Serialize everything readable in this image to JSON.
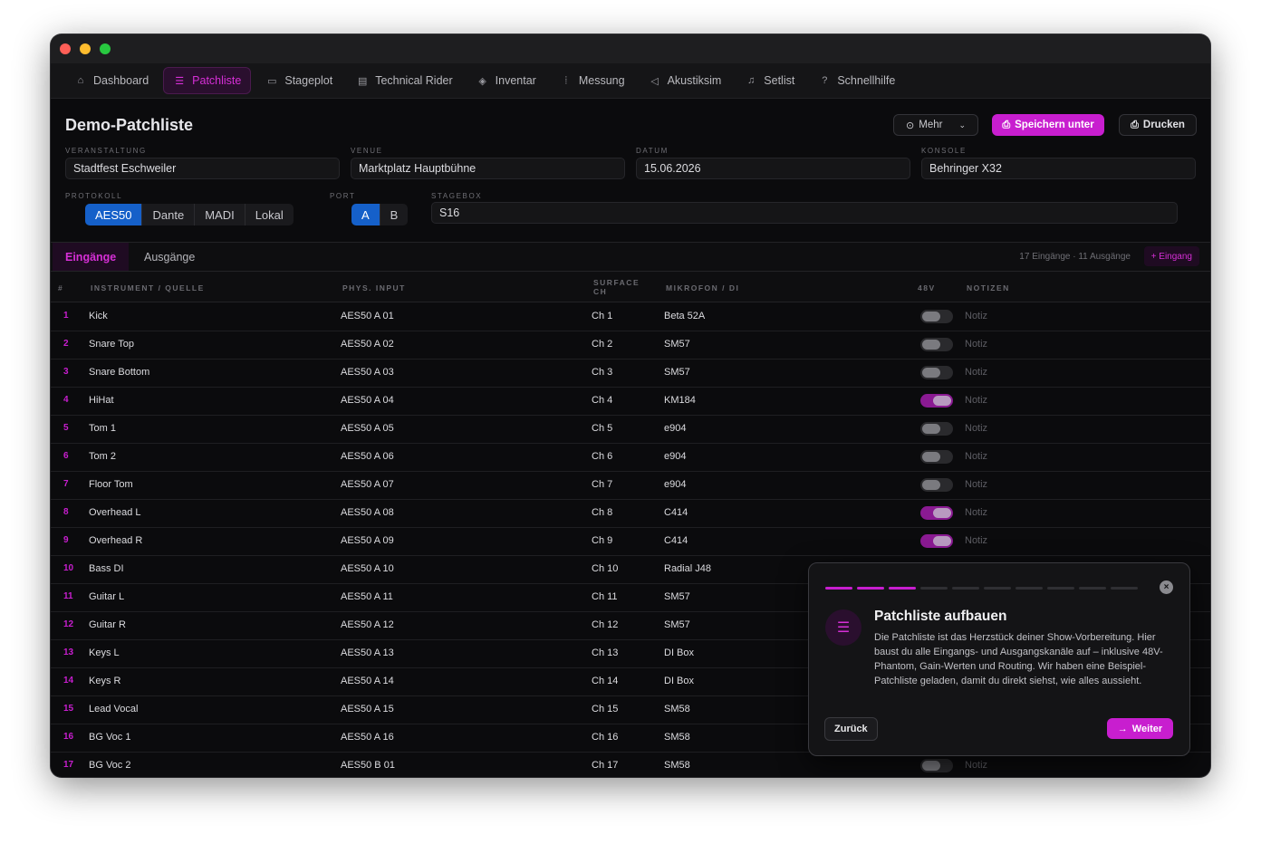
{
  "nav": [
    {
      "label": "Dashboard",
      "icon": "home-icon",
      "active": false
    },
    {
      "label": "Patchliste",
      "icon": "list-icon",
      "active": true
    },
    {
      "label": "Stageplot",
      "icon": "stageplot-icon",
      "active": false
    },
    {
      "label": "Technical Rider",
      "icon": "document-icon",
      "active": false
    },
    {
      "label": "Inventar",
      "icon": "box-icon",
      "active": false
    },
    {
      "label": "Messung",
      "icon": "waveform-icon",
      "active": false
    },
    {
      "label": "Akustiksim",
      "icon": "speaker-icon",
      "active": false
    },
    {
      "label": "Setlist",
      "icon": "music-icon",
      "active": false
    },
    {
      "label": "Schnellhilfe",
      "icon": "help-icon",
      "active": false
    }
  ],
  "header": {
    "title": "Demo-Patchliste",
    "more_label": "Mehr",
    "save_label": "Speichern unter",
    "print_label": "Drucken"
  },
  "fields": {
    "event_label": "Veranstaltung",
    "event_value": "Stadtfest Eschweiler",
    "venue_label": "Venue",
    "venue_value": "Marktplatz Hauptbühne",
    "date_label": "Datum",
    "date_value": "15.06.2026",
    "console_label": "Konsole",
    "console_value": "Behringer X32",
    "protocol_label": "Protokoll",
    "protocols": [
      "AES50",
      "Dante",
      "MADI",
      "Lokal"
    ],
    "protocol_selected": "AES50",
    "port_label": "Port",
    "ports": [
      "A",
      "B"
    ],
    "port_selected": "A",
    "stagebox_label": "Stagebox",
    "stagebox_value": "S16"
  },
  "tabs": {
    "inputs": "Eingänge",
    "outputs": "Ausgänge",
    "counts": "17 Eingänge · 11 Ausgänge",
    "add_label": "+ Eingang"
  },
  "columns": {
    "num": "#",
    "instrument": "Instrument / Quelle",
    "phys": "Phys. Input",
    "surface": "Surface Ch",
    "mic": "Mikrofon / DI",
    "phantom": "48V",
    "notes": "Notizen"
  },
  "rows": [
    {
      "n": "1",
      "instrument": "Kick",
      "input": "AES50 A 01",
      "ch": "Ch 1",
      "mic": "Beta 52A",
      "phantom": false,
      "note": "Notiz"
    },
    {
      "n": "2",
      "instrument": "Snare Top",
      "input": "AES50 A 02",
      "ch": "Ch 2",
      "mic": "SM57",
      "phantom": false,
      "note": "Notiz"
    },
    {
      "n": "3",
      "instrument": "Snare Bottom",
      "input": "AES50 A 03",
      "ch": "Ch 3",
      "mic": "SM57",
      "phantom": false,
      "note": "Notiz"
    },
    {
      "n": "4",
      "instrument": "HiHat",
      "input": "AES50 A 04",
      "ch": "Ch 4",
      "mic": "KM184",
      "phantom": true,
      "note": "Notiz"
    },
    {
      "n": "5",
      "instrument": "Tom 1",
      "input": "AES50 A 05",
      "ch": "Ch 5",
      "mic": "e904",
      "phantom": false,
      "note": "Notiz"
    },
    {
      "n": "6",
      "instrument": "Tom 2",
      "input": "AES50 A 06",
      "ch": "Ch 6",
      "mic": "e904",
      "phantom": false,
      "note": "Notiz"
    },
    {
      "n": "7",
      "instrument": "Floor Tom",
      "input": "AES50 A 07",
      "ch": "Ch 7",
      "mic": "e904",
      "phantom": false,
      "note": "Notiz"
    },
    {
      "n": "8",
      "instrument": "Overhead L",
      "input": "AES50 A 08",
      "ch": "Ch 8",
      "mic": "C414",
      "phantom": true,
      "note": "Notiz"
    },
    {
      "n": "9",
      "instrument": "Overhead R",
      "input": "AES50 A 09",
      "ch": "Ch 9",
      "mic": "C414",
      "phantom": true,
      "note": "Notiz"
    },
    {
      "n": "10",
      "instrument": "Bass DI",
      "input": "AES50 A 10",
      "ch": "Ch 10",
      "mic": "Radial J48",
      "phantom": true,
      "note": ""
    },
    {
      "n": "11",
      "instrument": "Guitar L",
      "input": "AES50 A 11",
      "ch": "Ch 11",
      "mic": "SM57",
      "phantom": false,
      "note": ""
    },
    {
      "n": "12",
      "instrument": "Guitar R",
      "input": "AES50 A 12",
      "ch": "Ch 12",
      "mic": "SM57",
      "phantom": false,
      "note": ""
    },
    {
      "n": "13",
      "instrument": "Keys L",
      "input": "AES50 A 13",
      "ch": "Ch 13",
      "mic": "DI Box",
      "phantom": false,
      "note": ""
    },
    {
      "n": "14",
      "instrument": "Keys R",
      "input": "AES50 A 14",
      "ch": "Ch 14",
      "mic": "DI Box",
      "phantom": false,
      "note": ""
    },
    {
      "n": "15",
      "instrument": "Lead Vocal",
      "input": "AES50 A 15",
      "ch": "Ch 15",
      "mic": "SM58",
      "phantom": false,
      "note": ""
    },
    {
      "n": "16",
      "instrument": "BG Voc 1",
      "input": "AES50 A 16",
      "ch": "Ch 16",
      "mic": "SM58",
      "phantom": false,
      "note": ""
    },
    {
      "n": "17",
      "instrument": "BG Voc 2",
      "input": "AES50 B 01",
      "ch": "Ch 17",
      "mic": "SM58",
      "phantom": false,
      "note": "Notiz"
    }
  ],
  "tour": {
    "title": "Patchliste aufbauen",
    "body": "Die Patchliste ist das Herzstück deiner Show-Vorbereitung. Hier baust du alle Eingangs- und Ausgangskanäle auf – inklusive 48V-Phantom, Gain-Werten und Routing. Wir haben eine Beispiel-Patchliste geladen, damit du direkt siehst, wie alles aussieht.",
    "back_label": "Zurück",
    "next_label": "Weiter",
    "steps_total": 10,
    "step_current": 3
  },
  "colors": {
    "accent": "#c81ecf",
    "selected_blue": "#1560c9"
  }
}
